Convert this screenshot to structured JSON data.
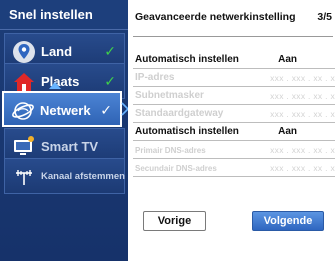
{
  "sidebar": {
    "header": "Snel instellen",
    "items": [
      {
        "label": "Land",
        "icon": "location-pin-icon",
        "checked": true
      },
      {
        "label": "Plaats",
        "icon": "house-icon",
        "checked": true
      },
      {
        "label": "Netwerk",
        "icon": "network-globe-icon",
        "checked": true,
        "active": true
      },
      {
        "label": "Smart TV",
        "icon": "tv-icon",
        "checked": false
      },
      {
        "label": "Kanaal afstemmen",
        "icon": "antenna-icon",
        "checked": false
      }
    ],
    "check_mark": "✓"
  },
  "main": {
    "title": "Geavanceerde netwerkinstelling",
    "page": "3/5",
    "rows": [
      {
        "label": "Automatisch instellen",
        "value": "Aan"
      },
      {
        "label": "IP-adres",
        "value": "xxx . xxx . xx . x"
      },
      {
        "label": "Subnetmasker",
        "value": "xxx . xxx . xx . x"
      },
      {
        "label": "Standaardgateway",
        "value": "xxx . xxx . xx . x"
      },
      {
        "label": "Automatisch instellen",
        "value": "Aan"
      },
      {
        "label": "Primair DNS-adres",
        "value": "xxx . xxx . xx . x"
      },
      {
        "label": "Secundair DNS-adres",
        "value": "xxx . xxx . xx . x"
      }
    ],
    "prev_button": "Vorige",
    "next_button": "Volgende"
  },
  "colors": {
    "sidebar_bg": "#1d3d78",
    "active_item": "#3f74c9",
    "check_green": "#3fcf4a",
    "accent_blue": "#69b4ff",
    "next_button": "#3a73cc"
  }
}
